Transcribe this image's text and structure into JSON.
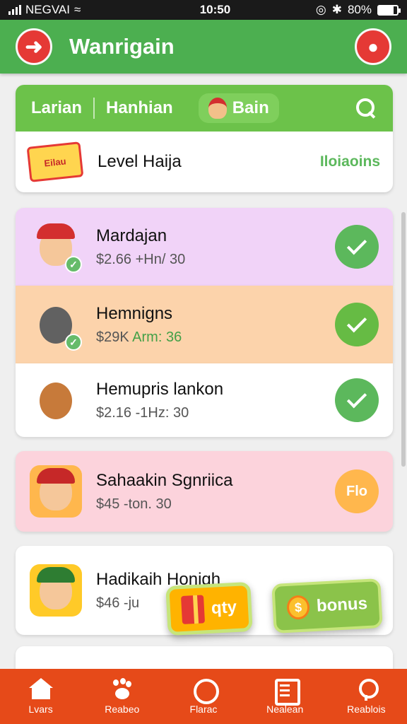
{
  "status_bar": {
    "carrier": "NEGVAI",
    "time": "10:50",
    "battery": "80%",
    "battery_level": 0.8
  },
  "app_bar": {
    "title": "Wanrigain"
  },
  "tabs": {
    "tab1": "Larian",
    "tab2": "Hanhian",
    "tab3": "Bain"
  },
  "level": {
    "badge": "Eilau",
    "title": "Level Haija",
    "link": "Iloiaoins"
  },
  "items": [
    {
      "name": "Mardajan",
      "price": "$2.66 +Hn/ 30",
      "status": "check"
    },
    {
      "name": "Hemnigns",
      "price_main": "$29K ",
      "price_hl": "Arm: 36",
      "status": "check"
    },
    {
      "name": "Hemupris lankon",
      "price": "$2.16 -1Hz: 30",
      "status": "check"
    },
    {
      "name": "Sahaakin Sgnriica",
      "price": "$45 -ton. 30",
      "status_label": "Flo"
    },
    {
      "name": "Hadikaih Honigh",
      "price": "$46 -ju"
    }
  ],
  "buttons": {
    "qty": "qty",
    "bonus": "bonus"
  },
  "bottom_nav": [
    {
      "label": "Lvars"
    },
    {
      "label": "Reabeo"
    },
    {
      "label": "Flarac"
    },
    {
      "label": "Nealean"
    },
    {
      "label": "Reablois"
    }
  ],
  "colors": {
    "primary": "#4caf50",
    "accent": "#e53935",
    "nav": "#e64a19"
  }
}
